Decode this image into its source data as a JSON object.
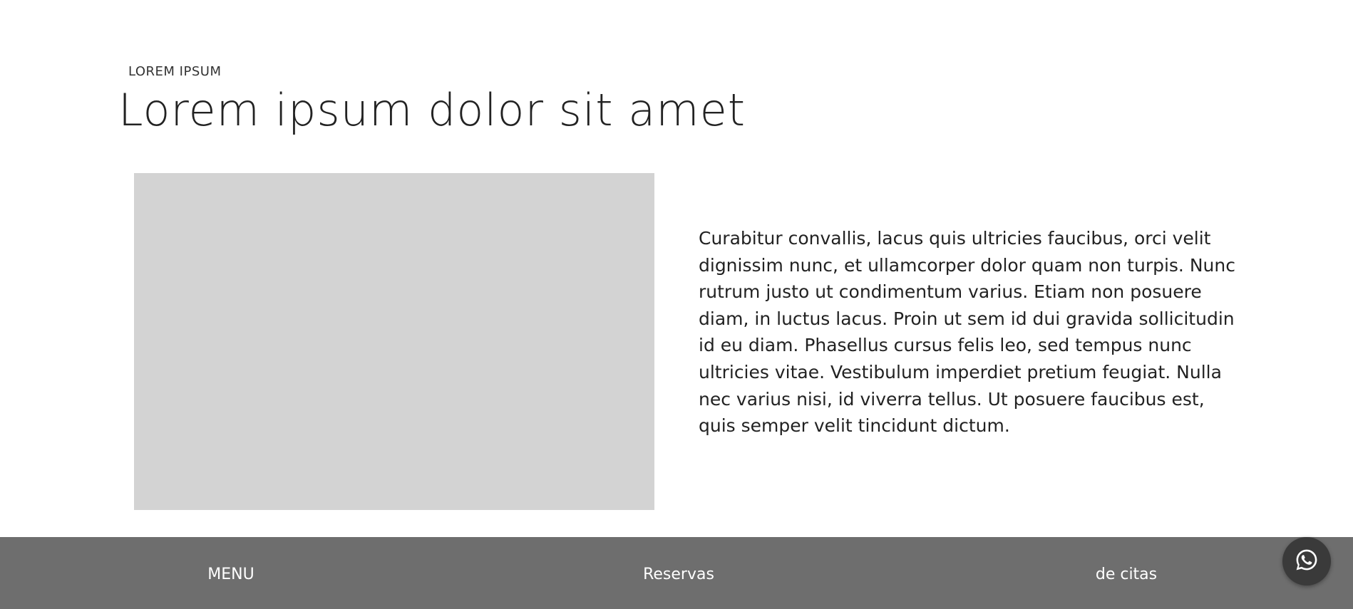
{
  "hero": {
    "eyebrow": "LOREM IPSUM",
    "headline": "Lorem ipsum dolor sit amet"
  },
  "content": {
    "paragraph": "Curabitur convallis, lacus quis ultricies faucibus, orci velit dignissim nunc, et ullamcorper dolor quam non turpis. Nunc rutrum justo ut condimentum varius. Etiam non posuere diam, in luctus lacus. Proin ut sem id dui gravida sollicitudin id eu diam. Phasellus cursus felis leo, sed tempus nunc ultricies vitae. Vestibulum imperdiet pretium feugiat. Nulla nec varius nisi, id viverra tellus. Ut posuere faucibus est, quis semper velit tincidunt dictum."
  },
  "footer": {
    "links": [
      {
        "label": "MENU"
      },
      {
        "label": "Reservas"
      },
      {
        "label": "de citas"
      }
    ]
  },
  "floating": {
    "icon": "whatsapp-icon"
  },
  "colors": {
    "footer_bg": "#6e6e6e",
    "placeholder_bg": "#d3d3d3",
    "whatsapp_bg": "#3a3a3a",
    "text": "#222222"
  }
}
